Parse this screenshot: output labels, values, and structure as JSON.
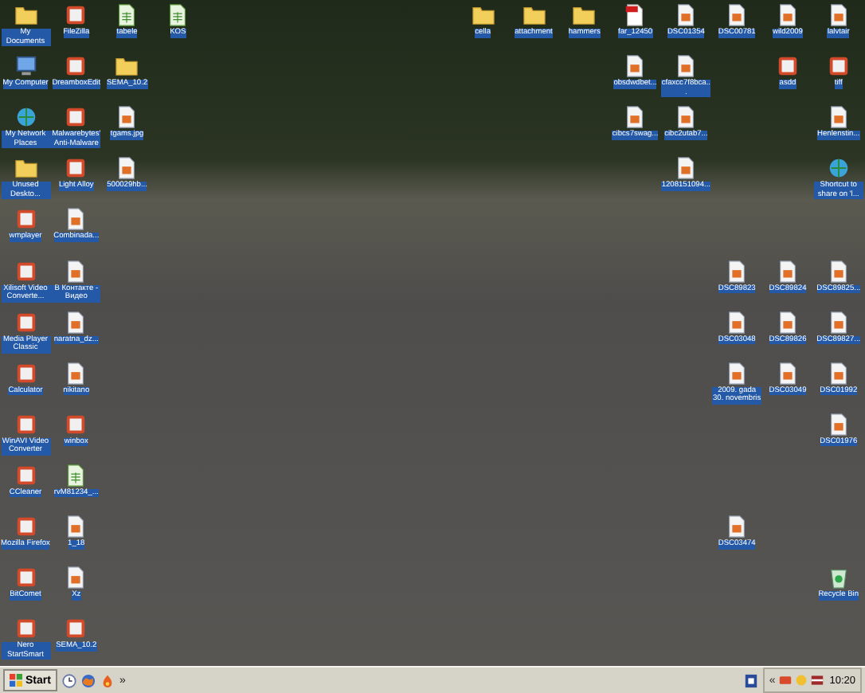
{
  "desktop": {
    "icons": [
      {
        "label": "My Documents",
        "kind": "folder"
      },
      {
        "label": "My Computer",
        "kind": "computer"
      },
      {
        "label": "My Network Places",
        "kind": "network"
      },
      {
        "label": "Unused Deskto...",
        "kind": "folder"
      },
      {
        "label": "wmplayer",
        "kind": "app"
      },
      {
        "label": "Xilisoft Video Converte...",
        "kind": "app"
      },
      {
        "label": "Media Player Classic",
        "kind": "app"
      },
      {
        "label": "Calculator",
        "kind": "app"
      },
      {
        "label": "WinAVI Video Converter",
        "kind": "app"
      },
      {
        "label": "CCleaner",
        "kind": "app"
      },
      {
        "label": "Mozilla Firefox",
        "kind": "app"
      },
      {
        "label": "BitComet",
        "kind": "app"
      },
      {
        "label": "Nero StartSmart",
        "kind": "app"
      },
      {
        "label": "FileZilla",
        "kind": "app"
      },
      {
        "label": "DreamboxEdit",
        "kind": "app"
      },
      {
        "label": "Malwarebytes' Anti-Malware",
        "kind": "app"
      },
      {
        "label": "Light Alloy",
        "kind": "app"
      },
      {
        "label": "Combinada...",
        "kind": "image"
      },
      {
        "label": "В Контакте - Видео",
        "kind": "image"
      },
      {
        "label": "naratna_dz...",
        "kind": "image"
      },
      {
        "label": "nikitano",
        "kind": "image"
      },
      {
        "label": "winbox",
        "kind": "app"
      },
      {
        "label": "rvM81234_...",
        "kind": "sheet"
      },
      {
        "label": "1_18",
        "kind": "image"
      },
      {
        "label": "Xz",
        "kind": "image"
      },
      {
        "label": "SEMA_10.2",
        "kind": "app"
      },
      {
        "label": "tabele",
        "kind": "sheet"
      },
      {
        "label": "SEMA_10.2",
        "kind": "folder"
      },
      {
        "label": "tgams.jpg",
        "kind": "image"
      },
      {
        "label": "500029hb...",
        "kind": "image"
      },
      {
        "label": "KOS",
        "kind": "sheet"
      },
      {
        "label": "cella",
        "kind": "folder"
      },
      {
        "label": "attachment",
        "kind": "folder"
      },
      {
        "label": "hammers",
        "kind": "folder"
      },
      {
        "label": "far_12450",
        "kind": "pdf"
      },
      {
        "label": "DSC01354",
        "kind": "image"
      },
      {
        "label": "DSC00781",
        "kind": "image"
      },
      {
        "label": "wild2009",
        "kind": "image"
      },
      {
        "label": "lalvtair",
        "kind": "image"
      },
      {
        "label": "obsdwdbet...",
        "kind": "image"
      },
      {
        "label": "cfaxcc7f8bca...",
        "kind": "image"
      },
      {
        "label": "asdd",
        "kind": "app"
      },
      {
        "label": "tiff",
        "kind": "app"
      },
      {
        "label": "cibcs7swag...",
        "kind": "image"
      },
      {
        "label": "cibc2utab7...",
        "kind": "image"
      },
      {
        "label": "Henlenstin...",
        "kind": "image"
      },
      {
        "label": "1208151094...",
        "kind": "image"
      },
      {
        "label": "Shortcut to share on 'l...",
        "kind": "network"
      },
      {
        "label": "DSC89823",
        "kind": "image"
      },
      {
        "label": "DSC89824",
        "kind": "image"
      },
      {
        "label": "DSC89825...",
        "kind": "image"
      },
      {
        "label": "DSC03048",
        "kind": "image"
      },
      {
        "label": "DSC89826",
        "kind": "image"
      },
      {
        "label": "DSC89827...",
        "kind": "image"
      },
      {
        "label": "2009. gada 30. novembris",
        "kind": "image"
      },
      {
        "label": "DSC03049",
        "kind": "image"
      },
      {
        "label": "DSC01992",
        "kind": "image"
      },
      {
        "label": "DSC01976",
        "kind": "image"
      },
      {
        "label": "DSC03474",
        "kind": "image"
      },
      {
        "label": "Recycle Bin",
        "kind": "bin"
      }
    ]
  },
  "taskbar": {
    "start": "Start",
    "more": "»",
    "tray_toggle": "«",
    "clock": "10:20"
  }
}
